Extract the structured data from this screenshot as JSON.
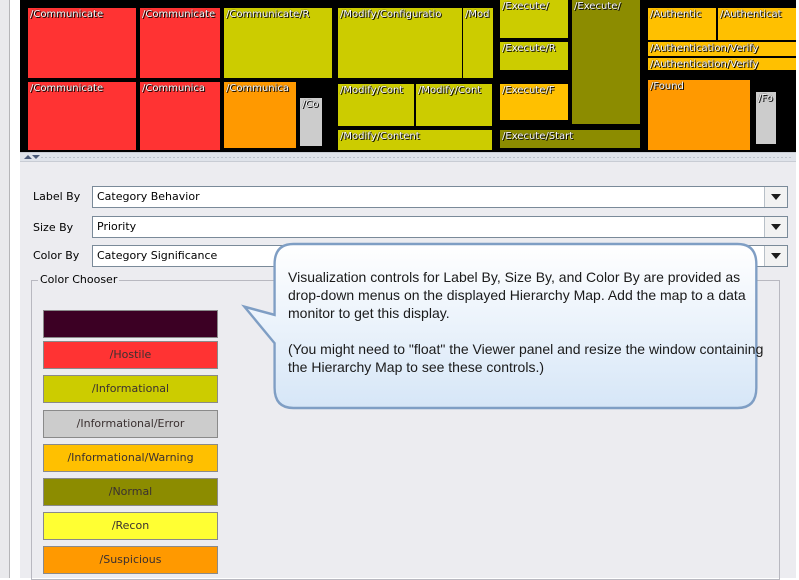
{
  "treemap": {
    "tiles": [
      {
        "label": "/Communicate",
        "color": "#ff3333"
      },
      {
        "label": "/Communicate",
        "color": "#ff3333"
      },
      {
        "label": "/Communicate/R",
        "color": "#cccc00"
      },
      {
        "label": "/Modify/Configuratio",
        "color": "#cccc00"
      },
      {
        "label": "/Mod",
        "color": "#cccc00"
      },
      {
        "label": "/Execute/",
        "color": "#cccc00"
      },
      {
        "label": "/Execute/",
        "color": "#8c8c00"
      },
      {
        "label": "/Execute/R",
        "color": "#cccc00"
      },
      {
        "label": "/Authentic",
        "color": "#ffc000"
      },
      {
        "label": "/Authenticat",
        "color": "#ffc000"
      },
      {
        "label": "/Authentication/Verify",
        "color": "#ffc000"
      },
      {
        "label": "/Authentication/Verify",
        "color": "#ffc000"
      },
      {
        "label": "/Communicate",
        "color": "#ff3333"
      },
      {
        "label": "/Communica",
        "color": "#ff3333"
      },
      {
        "label": "/Communica",
        "color": "#ff9900"
      },
      {
        "label": "/Co",
        "color": "#cccccc"
      },
      {
        "label": "/Modify/Cont",
        "color": "#cccc00"
      },
      {
        "label": "/Modify/Cont",
        "color": "#cccc00"
      },
      {
        "label": "/Modify/Content",
        "color": "#cccc00"
      },
      {
        "label": "/Execute/F",
        "color": "#ffc000"
      },
      {
        "label": "/Execute/Start",
        "color": "#8c8c00"
      },
      {
        "label": "/Found",
        "color": "#ff9900"
      },
      {
        "label": "/Fo",
        "color": "#cccccc"
      }
    ]
  },
  "controls": {
    "label_by": {
      "label": "Label By",
      "value": "Category Behavior"
    },
    "size_by": {
      "label": "Size By",
      "value": "Priority"
    },
    "color_by": {
      "label": "Color By",
      "value": "Category Significance"
    }
  },
  "color_chooser": {
    "title": "Color Chooser",
    "swatches": [
      {
        "label": "",
        "color": "#3c0024"
      },
      {
        "label": "/Hostile",
        "color": "#ff3333"
      },
      {
        "label": "/Informational",
        "color": "#cccc00"
      },
      {
        "label": "/Informational/Error",
        "color": "#cccccc"
      },
      {
        "label": "/Informational/Warning",
        "color": "#ffc000"
      },
      {
        "label": "/Normal",
        "color": "#8c8c00"
      },
      {
        "label": "/Recon",
        "color": "#ffff33"
      },
      {
        "label": "/Suspicious",
        "color": "#ff9900"
      }
    ]
  },
  "callout": {
    "paragraph1": "Visualization controls for Label By, Size By, and Color By are provided as drop-down menus on the displayed Hierarchy Map. Add the map to a data monitor to get this display.",
    "paragraph2": "(You might need to \"float\" the Viewer panel and resize the window containing the Hierarchy Map to see these controls.)"
  }
}
